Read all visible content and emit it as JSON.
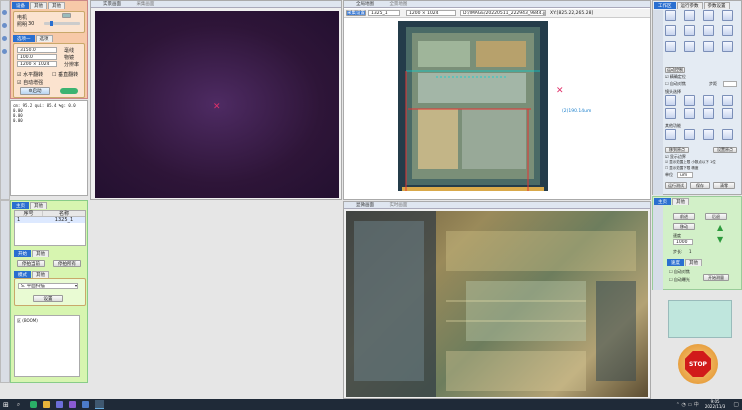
{
  "left_top": {
    "tabs": [
      "设备",
      "其他",
      "其他"
    ],
    "motor_label": "电机",
    "light_label": "照明",
    "light_value": "30",
    "sub_tabs": [
      "选项一",
      "选项"
    ],
    "fields": [
      {
        "value": "3150.0",
        "label": "毫线"
      },
      {
        "value": "100.0",
        "label": "物镜"
      },
      {
        "value": "1200 × 1024",
        "label": "分辨率"
      }
    ],
    "check_h": "水平翻转",
    "check_v": "垂直翻转",
    "check_auto": "自动增强",
    "start_btn": "启动",
    "side_tools": [
      "截图",
      "录像",
      "设置",
      "帮助"
    ]
  },
  "left_log": {
    "lines": [
      "cm: 95.2 qui: 85.4 %g: 0.0",
      "0.00",
      "0.00",
      "0.00"
    ]
  },
  "left_bottom": {
    "tabs": [
      "主页",
      "其他"
    ],
    "table_headers": [
      "序号",
      "名称"
    ],
    "table_rows": [
      [
        "1",
        "1325_1"
      ]
    ],
    "tabs2": [
      "开始",
      "其他"
    ],
    "btn_a": "停拍当前",
    "btn_b": "停拍所有",
    "tabs3": [
      "模式",
      "其他"
    ],
    "select_value": "S. 平面扫描",
    "confirm_btn": "设置",
    "log_text": "区 (BOOM)"
  },
  "cam_panel": {
    "title": "实景画面",
    "title2": "采集画面"
  },
  "map_panel": {
    "title": "全局地图",
    "title2": "全景地图",
    "toolbar_label": "采集设置",
    "toolbar_field1": "1325_1",
    "toolbar_field2": "1200 × 1024",
    "toolbar_path": "D:/IMAGE/20220511_222943_9844.jpg",
    "coords": "XY:[825.22,265.28]",
    "measure": "(2)190.14um"
  },
  "micro_panel": {
    "title": "显微画面",
    "title2": "实时画面"
  },
  "right_panel": {
    "tabs": [
      "工作区",
      "运行参数",
      "参数设置"
    ],
    "section1": "运动控制",
    "check1": "精确定位",
    "check2": "自动对焦",
    "input_label": "步距",
    "section2": "镜头选择",
    "section3": "其他功能",
    "btn_a": "移到原点",
    "btn_b": "设置原点",
    "check3": "显示边界",
    "check4": "显示范围上限 小数点以下 1位",
    "check5": "显示范围下限 精度",
    "select_label": "单位",
    "select_value": "um",
    "btn_c": "运行测试",
    "btn_d": "保存",
    "btn_e": "清零",
    "tabs2": [
      "主页",
      "其他"
    ],
    "ctrl_btn1": "前进",
    "ctrl_btn2": "后退",
    "ctrl_btn3": "移动",
    "speed_label": "速度",
    "speed_value": "1000",
    "step_label": "步长:",
    "step_value": "1",
    "tabs3": [
      "速度",
      "其他"
    ],
    "check6": "自动对焦",
    "check7": "自动曝光",
    "ctrl_btn4": "开始测量",
    "stop_label": "STOP"
  },
  "taskbar": {
    "time": "9:05",
    "date": "2022/11/3"
  }
}
